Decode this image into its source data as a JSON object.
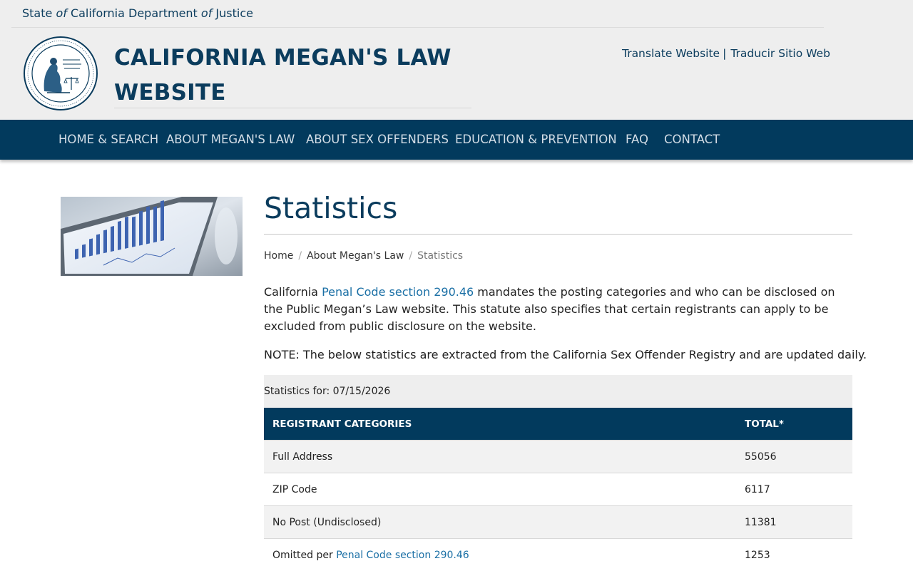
{
  "header": {
    "state_prefix": "State ",
    "state_of1": "of",
    "state_mid": " California Department ",
    "state_of2": "of",
    "state_suffix": " Justice",
    "site_title": "CALIFORNIA MEGAN'S LAW WEBSITE",
    "translate_label": "Translate Website",
    "translate_sep": "|",
    "traducir_label": "Traducir Sitio Web"
  },
  "nav": {
    "items": [
      {
        "label": "HOME & SEARCH"
      },
      {
        "label": "ABOUT MEGAN'S LAW"
      },
      {
        "label": "ABOUT SEX OFFENDERS"
      },
      {
        "label": "EDUCATION & PREVENTION"
      },
      {
        "label": "FAQ"
      },
      {
        "label": "CONTACT"
      }
    ]
  },
  "main": {
    "title": "Statistics",
    "breadcrumb": {
      "home": "Home",
      "sep": "/",
      "about": "About Megan's Law",
      "current": "Statistics"
    },
    "intro": {
      "before": "California ",
      "link": "Penal Code section 290.46",
      "after": " mandates the posting categories and who can be disclosed on the Public Megan’s Law website. This statute also specifies that certain registrants can apply to be excluded from public disclosure on the website."
    },
    "note": "NOTE: The below statistics are extracted from the California Sex Offender Registry and are updated daily.",
    "stats_for": "Statistics for: 07/15/2026",
    "table": {
      "col_category": "REGISTRANT CATEGORIES",
      "col_total": "TOTAL*",
      "rows": [
        {
          "category": "Full Address",
          "total": "55056"
        },
        {
          "category": "ZIP Code",
          "total": "6117"
        },
        {
          "category": "No Post (Undisclosed)",
          "total": "11381"
        },
        {
          "category_prefix": "Omitted per ",
          "category_link": "Penal Code section 290.46",
          "total": "1253"
        }
      ]
    }
  },
  "colors": {
    "brand_navy": "#023a5d",
    "title_blue": "#0b3c5d",
    "link_blue": "#1a6fa5"
  }
}
